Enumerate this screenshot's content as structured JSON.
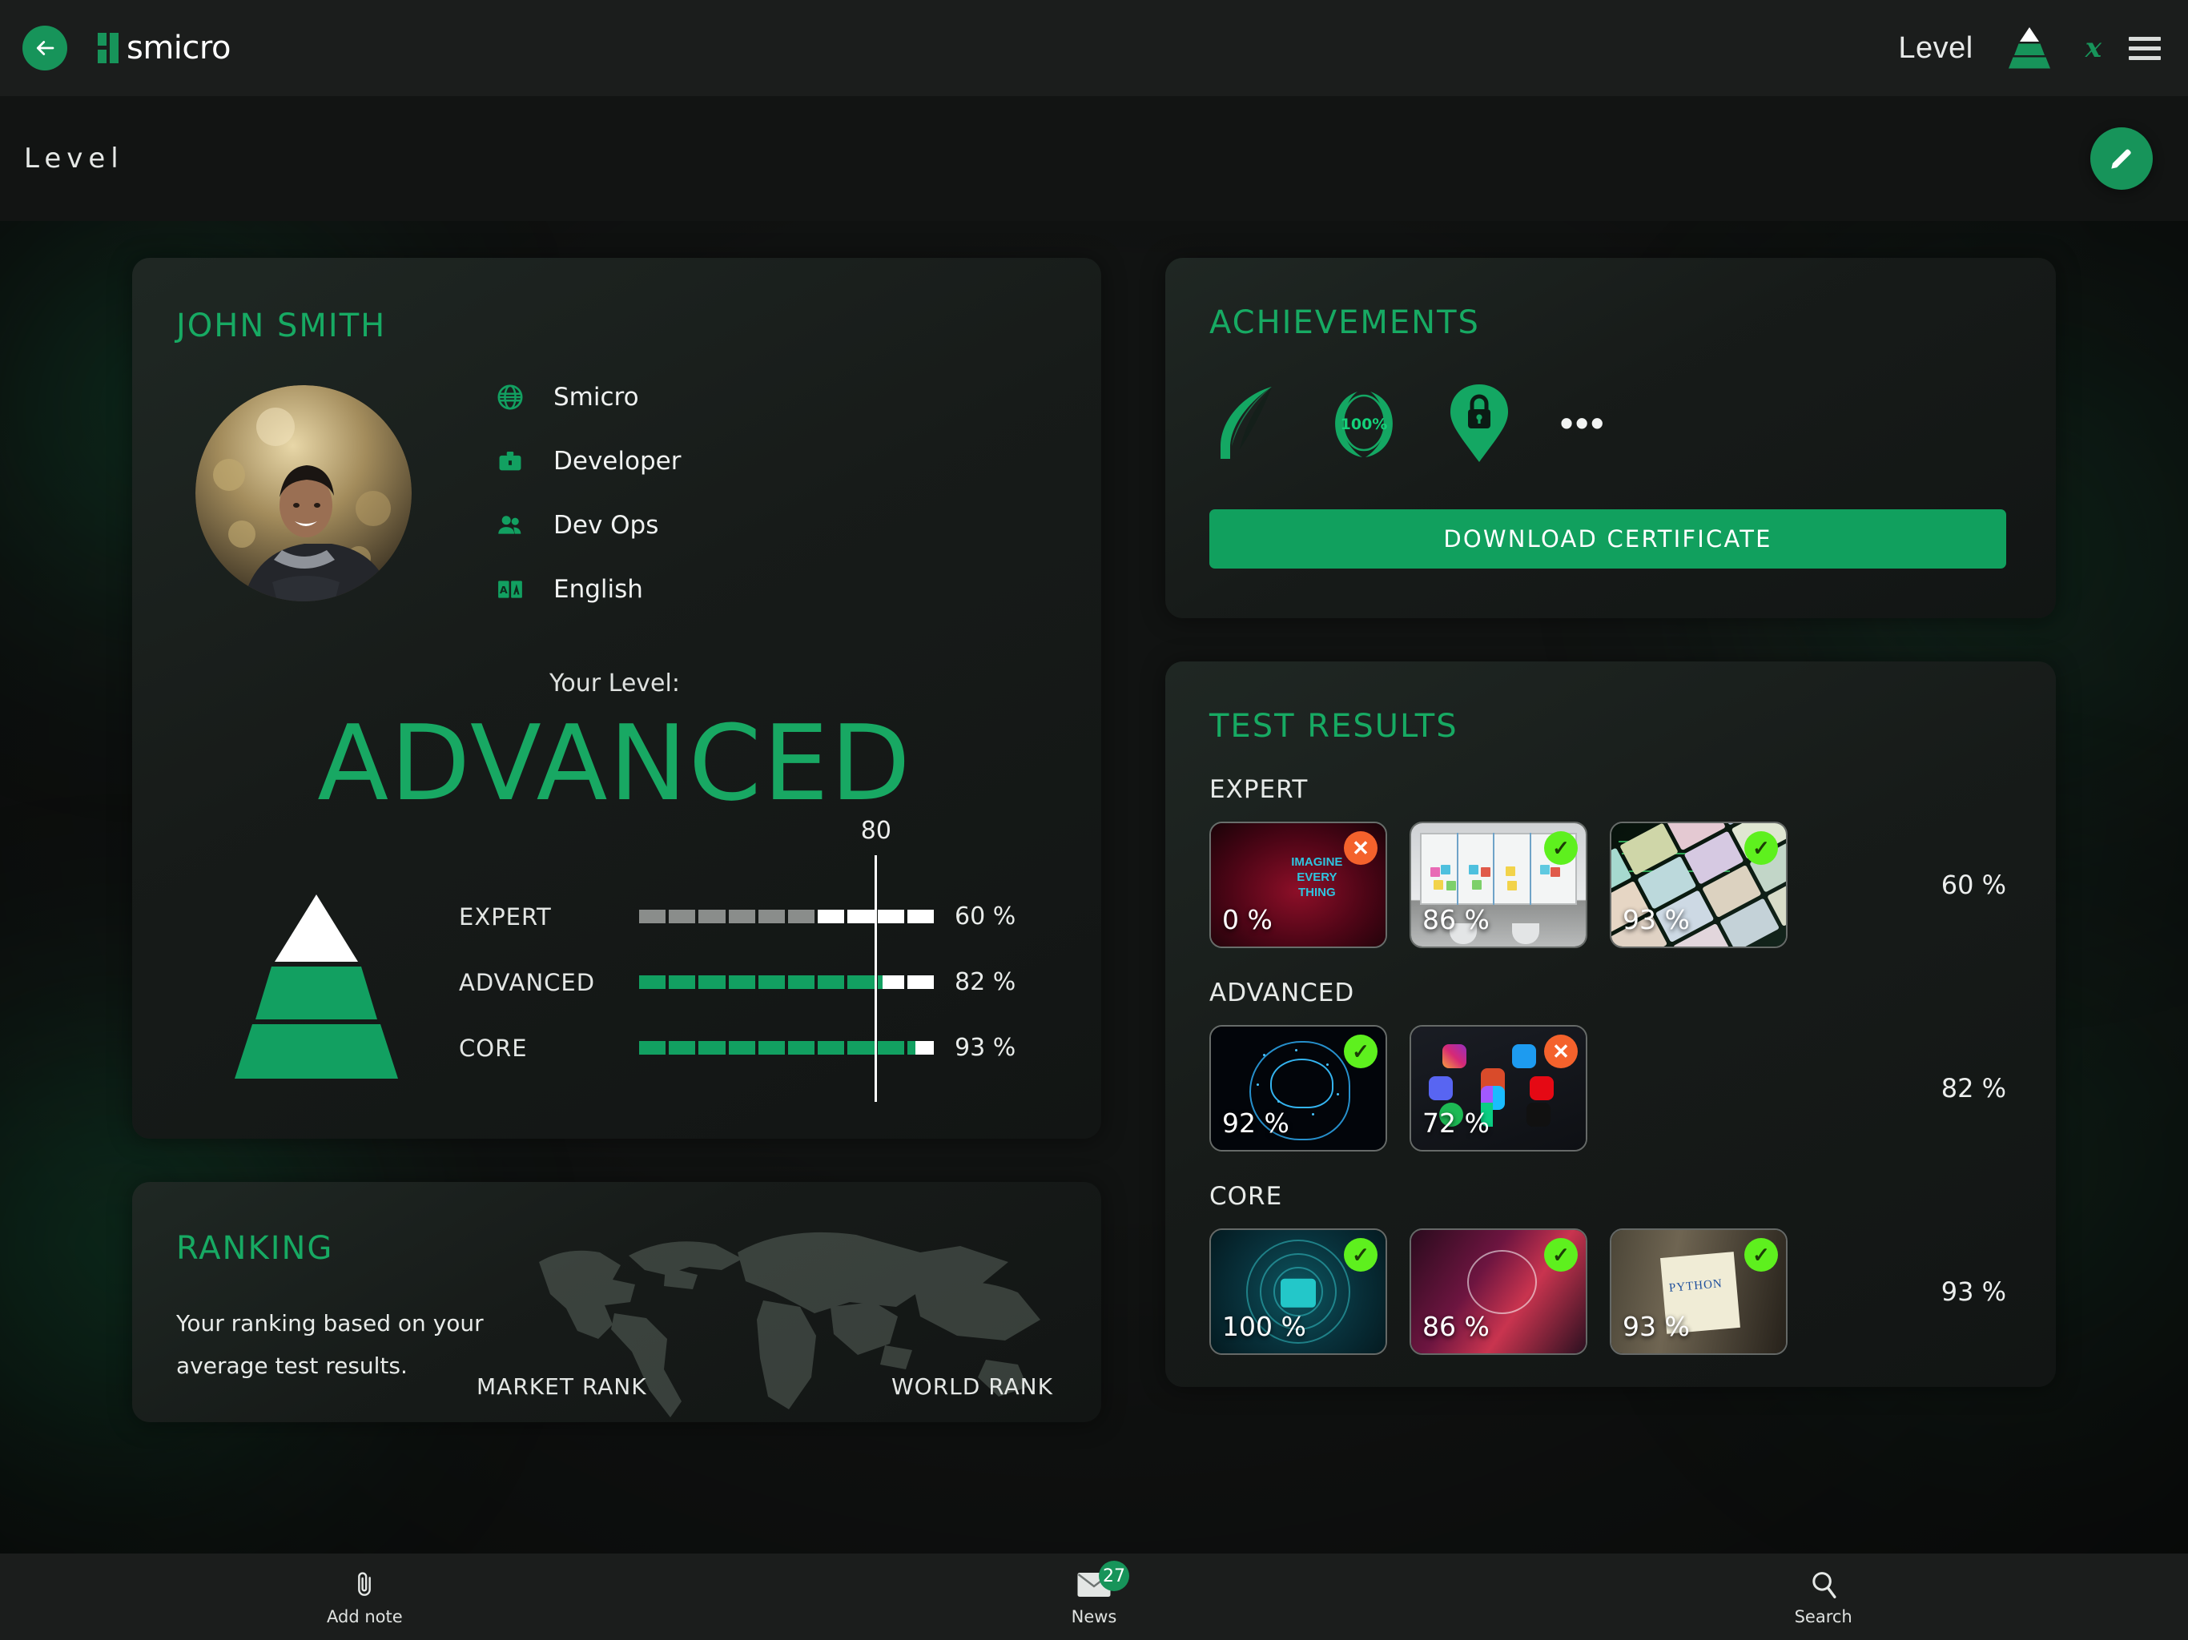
{
  "topbar": {
    "back_icon": "arrow-left-icon",
    "logo_text": "smicro",
    "level_label": "Level",
    "pyramid_icon": "level-pyramid-icon",
    "pin_icon": "x-pin-icon",
    "menu_icon": "hamburger-menu-icon"
  },
  "pagehead": {
    "title": "Level",
    "edit_icon": "pencil-edit-icon"
  },
  "profile": {
    "name": "JOHN SMITH",
    "avatar_alt": "user-avatar",
    "meta": [
      {
        "icon": "globe-icon",
        "label": "Smicro"
      },
      {
        "icon": "briefcase-icon",
        "label": "Developer"
      },
      {
        "icon": "people-icon",
        "label": "Dev Ops"
      },
      {
        "icon": "translate-icon",
        "label": "English"
      }
    ],
    "your_level_label": "Your Level:",
    "level_value": "ADVANCED"
  },
  "chart_data": {
    "type": "bar",
    "title": "Your Level: ADVANCED",
    "orientation": "horizontal",
    "categories": [
      "EXPERT",
      "ADVANCED",
      "CORE"
    ],
    "values": [
      60,
      82,
      93
    ],
    "value_labels": [
      "60 %",
      "82 %",
      "93 %"
    ],
    "segments": 10,
    "segment_colors": [
      "#8a8d8b",
      "#12a061",
      "#12a061"
    ],
    "empty_color": "#ffffff",
    "threshold": 80,
    "threshold_label": "80",
    "xlabel": "",
    "ylabel": "",
    "xlim": [
      0,
      100
    ],
    "grid": false,
    "legend": false
  },
  "ranking": {
    "title": "RANKING",
    "description": "Your ranking based on your average test results.",
    "market_rank_label": "MARKET RANK",
    "world_rank_label": "WORLD RANK"
  },
  "achievements": {
    "title": "ACHIEVEMENTS",
    "badges": [
      {
        "icon": "leaf-icon",
        "label": ""
      },
      {
        "icon": "laurel-100-icon",
        "label": "100%"
      },
      {
        "icon": "lock-pin-icon",
        "label": ""
      }
    ],
    "more": "•••",
    "download_label": "DOWNLOAD CERTIFICATE"
  },
  "test_results": {
    "title": "TEST RESULTS",
    "groups": [
      {
        "name": "EXPERT",
        "total": "60 %",
        "items": [
          {
            "art": "imagine",
            "pct": "0 %",
            "status": "fail",
            "badge": "✕"
          },
          {
            "art": "board",
            "pct": "86 %",
            "status": "pass",
            "badge": "✓"
          },
          {
            "art": "audio",
            "pct": "93 %",
            "status": "pass",
            "badge": "✓"
          }
        ]
      },
      {
        "name": "ADVANCED",
        "total": "82 %",
        "items": [
          {
            "art": "brain",
            "pct": "92 %",
            "status": "pass",
            "badge": "✓"
          },
          {
            "art": "social",
            "pct": "72 %",
            "status": "fail",
            "badge": "✕"
          }
        ]
      },
      {
        "name": "CORE",
        "total": "93 %",
        "items": [
          {
            "art": "cyber",
            "pct": "100 %",
            "status": "pass",
            "badge": "✓"
          },
          {
            "art": "bulb",
            "pct": "86 %",
            "status": "pass",
            "badge": "✓"
          },
          {
            "art": "python",
            "pct": "93 %",
            "status": "pass",
            "badge": "✓"
          }
        ]
      }
    ]
  },
  "bottombar": {
    "items": [
      {
        "icon": "paperclip-icon",
        "label": "Add note",
        "badge": ""
      },
      {
        "icon": "envelope-icon",
        "label": "News",
        "badge": "27"
      },
      {
        "icon": "search-icon",
        "label": "Search",
        "badge": ""
      }
    ]
  },
  "colors": {
    "accent": "#17945a",
    "accent_bright": "#18a863",
    "pass": "#5ef01e",
    "fail": "#f4622c",
    "bg": "#111312",
    "bar_expert": "#8a8d8b"
  }
}
